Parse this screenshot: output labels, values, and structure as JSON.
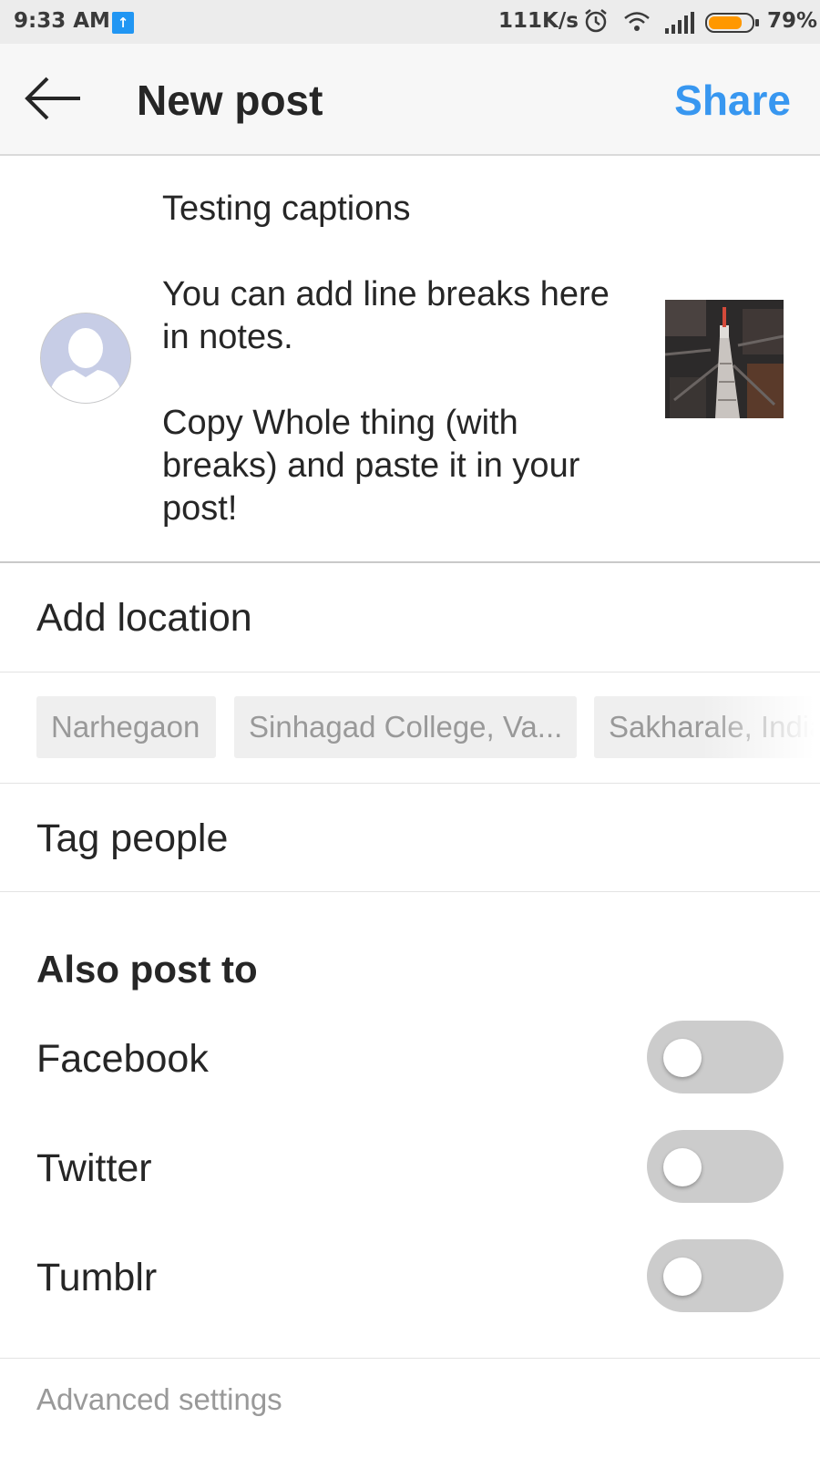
{
  "status_bar": {
    "time": "9:33 AM",
    "upload_icon": "upload-arrow-icon",
    "net_speed": "111K/s",
    "battery_percent": "79%",
    "battery_level": 0.79,
    "battery_color": "#ff9800",
    "icons": [
      "alarm-icon",
      "wifi-icon",
      "signal-icon",
      "battery-icon"
    ]
  },
  "header": {
    "back_icon": "back-arrow-icon",
    "title": "New post",
    "share_label": "Share",
    "accent_color": "#3897f0"
  },
  "caption": {
    "text": "Testing captions\n\nYou can add line breaks here in notes.\n\nCopy Whole thing (with breaks) and paste it in your post!",
    "avatar_icon": "default-avatar-icon",
    "thumbnail": "tower-aerial-photo"
  },
  "location": {
    "label": "Add location",
    "suggestions": [
      "Narhegaon",
      "Sinhagad College, Va...",
      "Sakharale, India"
    ]
  },
  "tag_people": {
    "label": "Tag people"
  },
  "also_post_to": {
    "heading": "Also post to",
    "options": [
      {
        "label": "Facebook",
        "enabled": false
      },
      {
        "label": "Twitter",
        "enabled": false
      },
      {
        "label": "Tumblr",
        "enabled": false
      }
    ]
  },
  "advanced": {
    "label": "Advanced settings"
  }
}
